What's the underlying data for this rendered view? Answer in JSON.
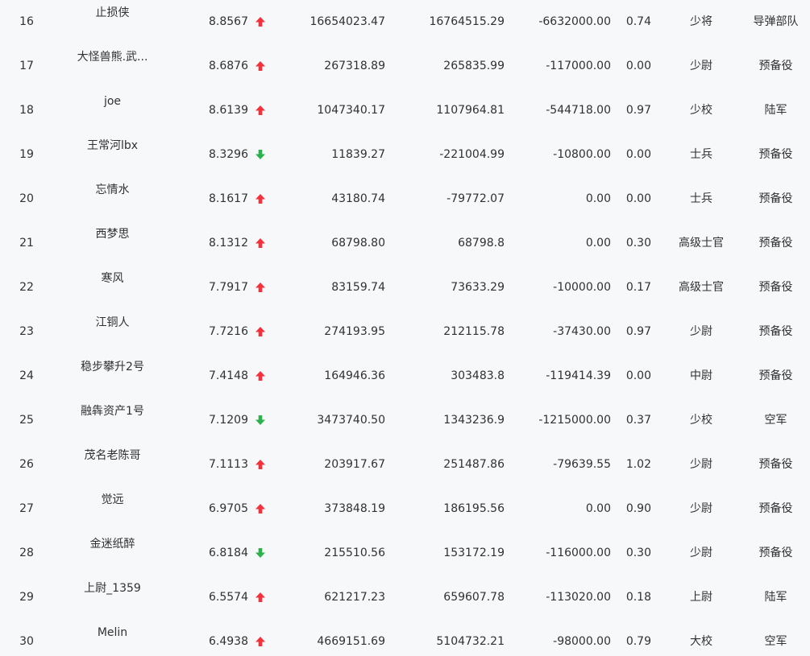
{
  "rows": [
    {
      "rank": "16",
      "name": "止损侠",
      "score": "8.8567",
      "trend": "up",
      "v1": "16654023.47",
      "v2": "16764515.29",
      "v3": "-6632000.00",
      "v4": "0.74",
      "mil_rank": "少将",
      "unit": "导弹部队"
    },
    {
      "rank": "17",
      "name": "大怪兽熊.武...",
      "score": "8.6876",
      "trend": "up",
      "v1": "267318.89",
      "v2": "265835.99",
      "v3": "-117000.00",
      "v4": "0.00",
      "mil_rank": "少尉",
      "unit": "预备役"
    },
    {
      "rank": "18",
      "name": "joe",
      "score": "8.6139",
      "trend": "up",
      "v1": "1047340.17",
      "v2": "1107964.81",
      "v3": "-544718.00",
      "v4": "0.97",
      "mil_rank": "少校",
      "unit": "陆军"
    },
    {
      "rank": "19",
      "name": "王常河lbx",
      "score": "8.3296",
      "trend": "down",
      "v1": "11839.27",
      "v2": "-221004.99",
      "v3": "-10800.00",
      "v4": "0.00",
      "mil_rank": "士兵",
      "unit": "预备役"
    },
    {
      "rank": "20",
      "name": "忘情水",
      "score": "8.1617",
      "trend": "up",
      "v1": "43180.74",
      "v2": "-79772.07",
      "v3": "0.00",
      "v4": "0.00",
      "mil_rank": "士兵",
      "unit": "预备役"
    },
    {
      "rank": "21",
      "name": "西梦思",
      "score": "8.1312",
      "trend": "up",
      "v1": "68798.80",
      "v2": "68798.8",
      "v3": "0.00",
      "v4": "0.30",
      "mil_rank": "高级士官",
      "unit": "预备役"
    },
    {
      "rank": "22",
      "name": "寒风",
      "score": "7.7917",
      "trend": "up",
      "v1": "83159.74",
      "v2": "73633.29",
      "v3": "-10000.00",
      "v4": "0.17",
      "mil_rank": "高级士官",
      "unit": "预备役"
    },
    {
      "rank": "23",
      "name": "江铜人",
      "score": "7.7216",
      "trend": "up",
      "v1": "274193.95",
      "v2": "212115.78",
      "v3": "-37430.00",
      "v4": "0.97",
      "mil_rank": "少尉",
      "unit": "预备役"
    },
    {
      "rank": "24",
      "name": "稳步攀升2号",
      "score": "7.4148",
      "trend": "up",
      "v1": "164946.36",
      "v2": "303483.8",
      "v3": "-119414.39",
      "v4": "0.00",
      "mil_rank": "中尉",
      "unit": "预备役"
    },
    {
      "rank": "25",
      "name": "融犇资产1号",
      "score": "7.1209",
      "trend": "down",
      "v1": "3473740.50",
      "v2": "1343236.9",
      "v3": "-1215000.00",
      "v4": "0.37",
      "mil_rank": "少校",
      "unit": "空军"
    },
    {
      "rank": "26",
      "name": "茂名老陈哥",
      "score": "7.1113",
      "trend": "up",
      "v1": "203917.67",
      "v2": "251487.86",
      "v3": "-79639.55",
      "v4": "1.02",
      "mil_rank": "少尉",
      "unit": "预备役"
    },
    {
      "rank": "27",
      "name": "觉远",
      "score": "6.9705",
      "trend": "up",
      "v1": "373848.19",
      "v2": "186195.56",
      "v3": "0.00",
      "v4": "0.90",
      "mil_rank": "少尉",
      "unit": "预备役"
    },
    {
      "rank": "28",
      "name": "金迷纸醉",
      "score": "6.8184",
      "trend": "down",
      "v1": "215510.56",
      "v2": "153172.19",
      "v3": "-116000.00",
      "v4": "0.30",
      "mil_rank": "少尉",
      "unit": "预备役"
    },
    {
      "rank": "29",
      "name": "上尉_1359",
      "score": "6.5574",
      "trend": "up",
      "v1": "621217.23",
      "v2": "659607.78",
      "v3": "-113020.00",
      "v4": "0.18",
      "mil_rank": "上尉",
      "unit": "陆军"
    },
    {
      "rank": "30",
      "name": "Melin",
      "score": "6.4938",
      "trend": "up",
      "v1": "4669151.69",
      "v2": "5104732.21",
      "v3": "-98000.00",
      "v4": "0.79",
      "mil_rank": "大校",
      "unit": "空军"
    }
  ],
  "icons": {
    "up": "arrow-up-icon",
    "down": "arrow-down-icon"
  },
  "colors": {
    "up": "#f5313b",
    "down": "#2bb24c",
    "background": "#f7f8fa",
    "text": "#303133"
  }
}
